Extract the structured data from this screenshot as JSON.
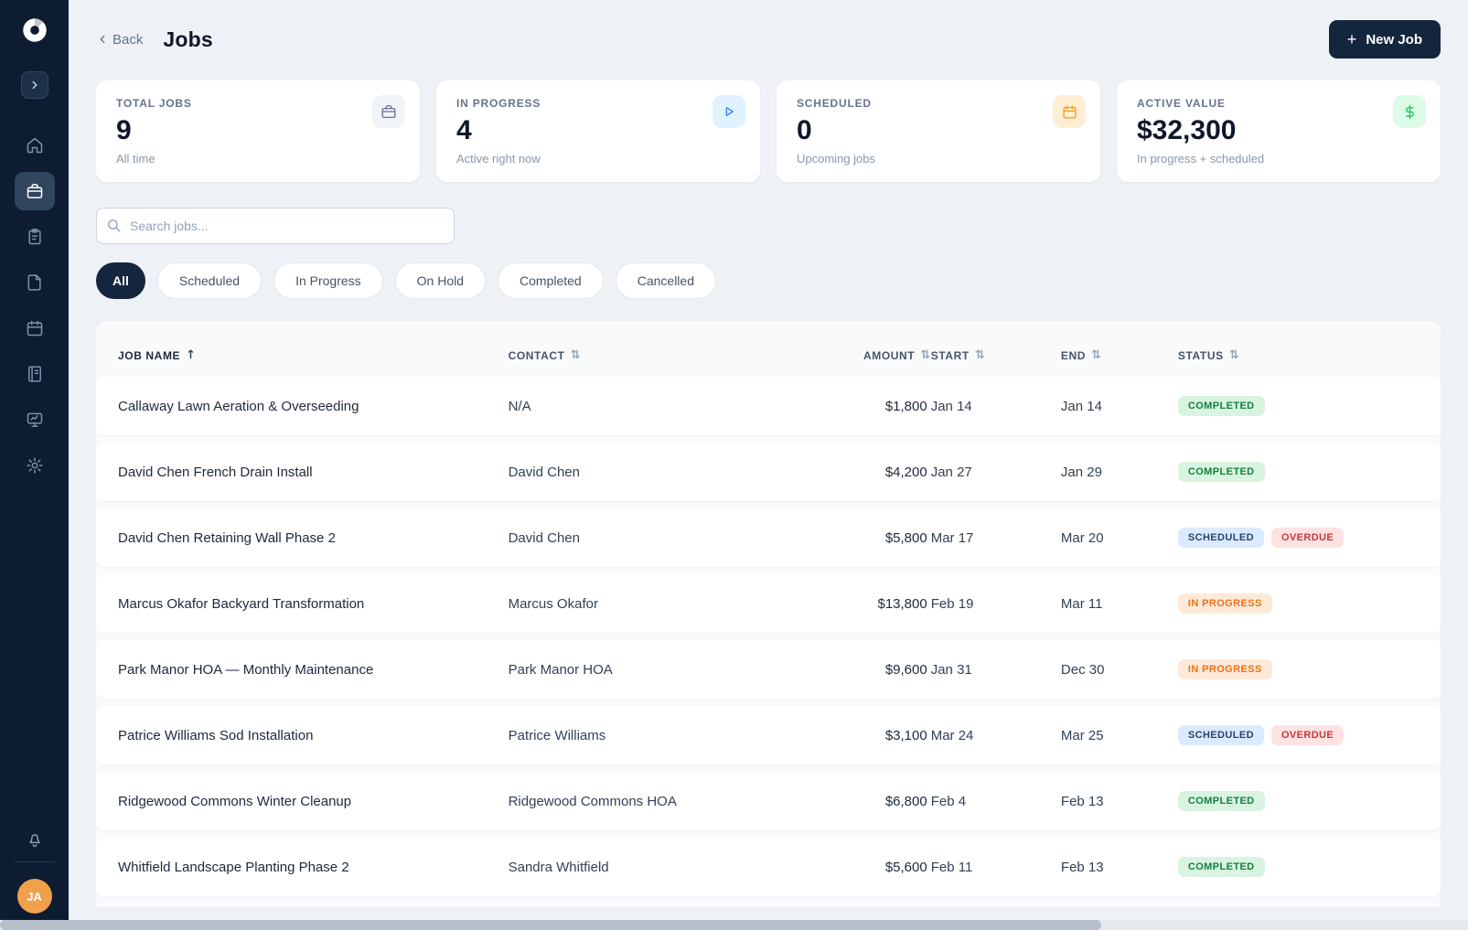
{
  "app": {
    "avatar_initials": "JA"
  },
  "sidebar": {
    "items": [
      "home",
      "jobs",
      "contacts",
      "documents",
      "calendar",
      "ledger",
      "dashboard",
      "settings"
    ],
    "active_item": "jobs"
  },
  "header": {
    "back_label": "Back",
    "title": "Jobs",
    "new_job_label": "New Job"
  },
  "stats": [
    {
      "label": "TOTAL JOBS",
      "value": "9",
      "subtitle": "All time",
      "icon": "briefcase-icon"
    },
    {
      "label": "IN PROGRESS",
      "value": "4",
      "subtitle": "Active right now",
      "icon": "play-icon"
    },
    {
      "label": "SCHEDULED",
      "value": "0",
      "subtitle": "Upcoming jobs",
      "icon": "calendar-icon"
    },
    {
      "label": "ACTIVE VALUE",
      "value": "$32,300",
      "subtitle": "In progress + scheduled",
      "icon": "dollar-icon"
    }
  ],
  "search": {
    "placeholder": "Search jobs..."
  },
  "filters": [
    {
      "label": "All",
      "active": true
    },
    {
      "label": "Scheduled",
      "active": false
    },
    {
      "label": "In Progress",
      "active": false
    },
    {
      "label": "On Hold",
      "active": false
    },
    {
      "label": "Completed",
      "active": false
    },
    {
      "label": "Cancelled",
      "active": false
    }
  ],
  "table": {
    "columns": [
      {
        "label": "JOB NAME",
        "sort": "asc"
      },
      {
        "label": "CONTACT",
        "sort": "none"
      },
      {
        "label": "AMOUNT",
        "sort": "none"
      },
      {
        "label": "START",
        "sort": "none"
      },
      {
        "label": "END",
        "sort": "none"
      },
      {
        "label": "STATUS",
        "sort": "none"
      }
    ],
    "rows": [
      {
        "name": "Callaway Lawn Aeration & Overseeding",
        "contact": "N/A",
        "amount": "$1,800",
        "start": "Jan 14",
        "end": "Jan 14",
        "statuses": [
          {
            "label": "COMPLETED",
            "type": "completed"
          }
        ]
      },
      {
        "name": "David Chen French Drain Install",
        "contact": "David Chen",
        "amount": "$4,200",
        "start": "Jan 27",
        "end": "Jan 29",
        "statuses": [
          {
            "label": "COMPLETED",
            "type": "completed"
          }
        ]
      },
      {
        "name": "David Chen Retaining Wall Phase 2",
        "contact": "David Chen",
        "amount": "$5,800",
        "start": "Mar 17",
        "end": "Mar 20",
        "statuses": [
          {
            "label": "SCHEDULED",
            "type": "scheduled"
          },
          {
            "label": "OVERDUE",
            "type": "overdue"
          }
        ]
      },
      {
        "name": "Marcus Okafor Backyard Transformation",
        "contact": "Marcus Okafor",
        "amount": "$13,800",
        "start": "Feb 19",
        "end": "Mar 11",
        "statuses": [
          {
            "label": "IN PROGRESS",
            "type": "inprogress"
          }
        ]
      },
      {
        "name": "Park Manor HOA — Monthly Maintenance",
        "contact": "Park Manor HOA",
        "amount": "$9,600",
        "start": "Jan 31",
        "end": "Dec 30",
        "statuses": [
          {
            "label": "IN PROGRESS",
            "type": "inprogress"
          }
        ]
      },
      {
        "name": "Patrice Williams Sod Installation",
        "contact": "Patrice Williams",
        "amount": "$3,100",
        "start": "Mar 24",
        "end": "Mar 25",
        "statuses": [
          {
            "label": "SCHEDULED",
            "type": "scheduled"
          },
          {
            "label": "OVERDUE",
            "type": "overdue"
          }
        ]
      },
      {
        "name": "Ridgewood Commons Winter Cleanup",
        "contact": "Ridgewood Commons HOA",
        "amount": "$6,800",
        "start": "Feb 4",
        "end": "Feb 13",
        "statuses": [
          {
            "label": "COMPLETED",
            "type": "completed"
          }
        ]
      },
      {
        "name": "Whitfield Landscape Planting Phase 2",
        "contact": "Sandra Whitfield",
        "amount": "$5,600",
        "start": "Feb 11",
        "end": "Feb 13",
        "statuses": [
          {
            "label": "COMPLETED",
            "type": "completed"
          }
        ]
      }
    ]
  },
  "colors": {
    "sidebar_bg": "#0d1c31",
    "accent_navy": "#13263d",
    "status_completed": "#15803d",
    "status_scheduled": "#27456b",
    "status_overdue": "#c23a3a",
    "status_inprogress": "#ea7317",
    "avatar_bg": "#f0a04b"
  }
}
